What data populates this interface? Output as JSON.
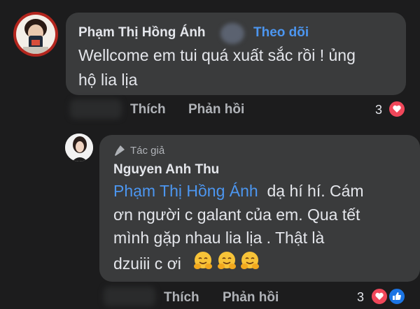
{
  "comment1": {
    "name": "Phạm Thị Hồng Ánh",
    "follow": "Theo dõi",
    "text_line1": "Wellcome em tui quá xuất sắc rồi ! ủng",
    "text_line2": "hộ lia lịa",
    "actions": {
      "like": "Thích",
      "reply": "Phản hồi"
    },
    "reaction_count": "3",
    "reactions": [
      "heart-icon"
    ]
  },
  "comment2": {
    "author_tag": "Tác giả",
    "name": "Nguyen Anh Thu",
    "mention": "Phạm Thị Hồng Ánh",
    "text_line1_rest": "dạ hí hí. Cám",
    "text_line2": "ơn người c galant của em. Qua tết",
    "text_line3": "mình gặp nhau lia lịa . Thật là",
    "text_line4": "dzuiii c ơi",
    "emojis": [
      "hugging-face-icon",
      "hugging-face-icon",
      "hugging-face-icon"
    ],
    "actions": {
      "like": "Thích",
      "reply": "Phản hồi"
    },
    "reaction_count": "3",
    "reactions": [
      "heart-icon",
      "like-icon"
    ]
  },
  "colors": {
    "background": "#1c1c1d",
    "bubble": "#3a3b3c",
    "link": "#4c96f0",
    "muted": "#b0b3b8"
  }
}
